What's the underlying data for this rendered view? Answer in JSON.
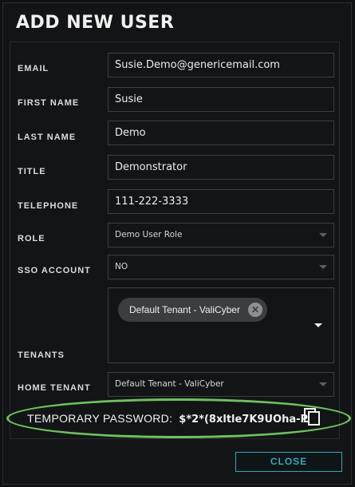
{
  "dialog": {
    "title": "ADD NEW USER"
  },
  "form": {
    "email": {
      "label": "EMAIL",
      "value": "Susie.Demo@genericemail.com"
    },
    "first_name": {
      "label": "FIRST NAME",
      "value": "Susie"
    },
    "last_name": {
      "label": "LAST NAME",
      "value": "Demo"
    },
    "title": {
      "label": "TITLE",
      "value": "Demonstrator"
    },
    "telephone": {
      "label": "TELEPHONE",
      "value": "111-222-3333"
    },
    "role": {
      "label": "ROLE",
      "value": "Demo User Role"
    },
    "sso_account": {
      "label": "SSO ACCOUNT",
      "value": "NO"
    },
    "tenants": {
      "label": "TENANTS",
      "chips": [
        "Default Tenant - ValiCyber"
      ]
    },
    "home_tenant": {
      "label": "HOME TENANT",
      "value": "Default Tenant - ValiCyber"
    }
  },
  "temporary_password": {
    "label": "TEMPORARY PASSWORD:",
    "value": "$*2*(8xltle7K9UOha-P"
  },
  "buttons": {
    "close": "CLOSE"
  },
  "colors": {
    "accent": "#2fa7b8",
    "highlight_ellipse": "#6dc25e"
  },
  "icons": {
    "copy": "copy-icon",
    "chip_remove": "close-circle-icon",
    "dropdown": "chevron-down-icon"
  }
}
